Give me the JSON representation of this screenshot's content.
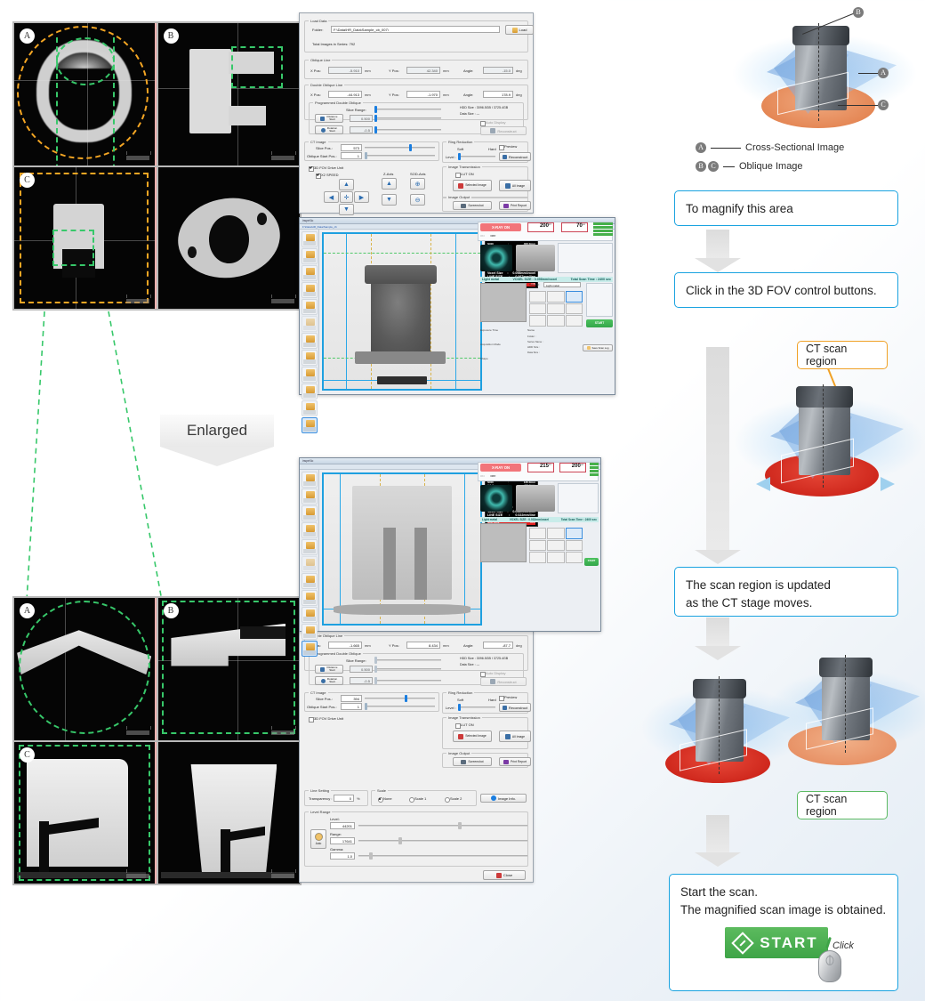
{
  "ct_views_top": {
    "panel_labels": [
      "A",
      "B",
      "C",
      ""
    ],
    "overlay_note": "orange and green dashed ROI guides"
  },
  "ct_views_bottom": {
    "panel_labels": [
      "A",
      "B",
      "C",
      ""
    ]
  },
  "enlarged_arrow": {
    "label": "Enlarged"
  },
  "control_panel": {
    "load_data": {
      "group": "Load Data",
      "folder_label": "Folder:",
      "folder_value": "F:\\Data\\HR_Data\\Sample_cb_007\\",
      "load_button": "Load",
      "total_images_label": "Total Images in Series: 792"
    },
    "oblique_line": {
      "group": "Oblique Line",
      "x_label": "X Pos:",
      "x_value": "-5.910",
      "x_unit": "mm",
      "y_label": "Y Pos:",
      "y_value": "42.340",
      "y_unit": "mm",
      "angle_label": "Angle:",
      "angle_value": "-15.0",
      "angle_unit": "deg"
    },
    "double_oblique_line": {
      "group": "Double Oblique Line",
      "x_label": "X Pos:",
      "x_value": "-44.913",
      "x_unit": "mm",
      "y_label": "Y Pos:",
      "y_value": "-1.970",
      "y_unit": "mm",
      "angle_label": "Angle:",
      "angle_value": "178.9",
      "angle_unit": "deg"
    },
    "programmed_double_oblique": {
      "group": "Programmed Double Oblique",
      "slice_range_label": "Slice Range:",
      "distance_button": "Distance\nStart",
      "rotation_button": "Rotation\nStart",
      "distance_value": "0.500",
      "rotation_value": "-0.5",
      "hdd_size_label": "HDD Size : 3096.5GB / 3725.4GB",
      "data_size_label": "Data Size : ---",
      "auto_display": "Auto Display",
      "reconstruct_button": "Reconstruct"
    },
    "ct_image": {
      "group": "CT Image",
      "slice_pos_label": "Slice Pos.:",
      "slice_pos_value": "573",
      "oblique_start_label": "Oblique Start Pos.:",
      "oblique_start_value": "1"
    },
    "ring_reduction": {
      "group": "Ring Reduction",
      "soft_label": "Soft",
      "hard_label": "Hard",
      "preview_label": "Preview",
      "level_label": "Level :",
      "reconstruct_button": "Reconstruct"
    },
    "fov_drive": {
      "fov_checkbox": "3D FOV Drive Unit",
      "speed_checkbox": "X2 SPEED",
      "z_axis_label": "Z-Axis",
      "sod_axis_label": "SOD-Axis"
    },
    "image_transmission": {
      "group": "Image Transmission",
      "lut_checkbox": "LUT ON",
      "selected_image_button": "Selected Image",
      "all_image_button": "All Image"
    },
    "image_output": {
      "group": "Image Output",
      "screenshot_button": "Screenshot",
      "print_report_button": "Print Report"
    }
  },
  "control_panel_bottom": {
    "double_oblique_line": {
      "group": "Double Oblique Line",
      "x_label": "X Pos:",
      "x_value": "-1.665",
      "x_unit": "mm",
      "y_label": "Y Pos:",
      "y_value": "8.434",
      "y_unit": "mm",
      "angle_label": "Angle:",
      "angle_value": "-87.7",
      "angle_unit": "deg"
    },
    "programmed_double_oblique": {
      "group": "Programmed Double Oblique",
      "slice_range_label": "Slice Range:",
      "distance_button": "Distance\nStart",
      "rotation_button": "Rotation\nStart",
      "distance_value": "0.500",
      "rotation_value": "-0.5",
      "hdd_size_label": "HDD Size : 3096.5GB / 3725.4GB",
      "data_size_label": "Data Size : ---",
      "auto_display": "Auto Display",
      "reconstruct_button": "Reconstruct"
    },
    "ct_image": {
      "group": "CT Image",
      "slice_pos_label": "Slice Pos.:",
      "slice_pos_value": "394",
      "oblique_start_label": "Oblique Start Pos.:",
      "oblique_start_value": "1"
    },
    "ring_reduction": {
      "group": "Ring Reduction",
      "soft_label": "Soft",
      "hard_label": "Hard",
      "preview_label": "Preview",
      "level_label": "Level :",
      "reconstruct_button": "Reconstruct"
    },
    "fov_drive": {
      "fov_checkbox": "3D FOV Drive Unit"
    },
    "image_transmission": {
      "group": "Image Transmission",
      "lut_checkbox": "LUT ON",
      "selected_image_button": "Selected Image",
      "all_image_button": "All Image"
    },
    "image_output": {
      "group": "Image Output",
      "screenshot_button": "Screenshot",
      "print_report_button": "Print Report"
    },
    "line_setting": {
      "group": "Line Setting",
      "transparency_label": "Transparency :",
      "transparency_value": "0",
      "transparency_unit": "%"
    },
    "scale": {
      "group": "Scale",
      "options": [
        "None",
        "Scale 1",
        "Scale 2"
      ],
      "selected": "None",
      "image_info_button": "Image Info."
    },
    "level_range": {
      "group": "Level Range",
      "level_label": "Level:",
      "level_value": "44201",
      "range_label": "Range:",
      "range_value": "17641",
      "gamma_label": "Gamma:",
      "gamma_value": "1.0",
      "auto_button": "Auto"
    },
    "close_button": "Close"
  },
  "scan_window_top": {
    "title": "inspeXio",
    "breadcrumb": "F:\\Data\\HR_Data\\Sample_cb",
    "xray_status": "X-RAY ON",
    "toggle_on": "ON",
    "toggle_off": "OFF",
    "voltage_value": "200",
    "voltage_unit": "kV",
    "current_value": "70",
    "current_unit": "uA",
    "information": {
      "header": "Information",
      "rows": [
        {
          "k": "SID",
          "v": "800.0mm"
        },
        {
          "k": "SOD",
          "v": "400.0mm"
        },
        {
          "k": "CT-Z",
          "v": "201.5mm"
        },
        {
          "k": "CT-Theta",
          "v": "0.0 deg."
        },
        {
          "k": "X",
          "v": "0.0mm"
        },
        {
          "k": "Y",
          "v": "0.0mm"
        },
        {
          "k": "Inch Size",
          "v": "16.4inch"
        },
        {
          "k": "FOV (Z)",
          "v": "150.0mm"
        },
        {
          "k": "FOV (XY)",
          "v": "201.7mm"
        },
        {
          "k": "Voxel Size",
          "v": "0.098mm/voxel"
        },
        {
          "k": "LINE SIZE",
          "v": "0.067mm/line"
        },
        {
          "k": "Sample Size",
          "v": "150.0mm"
        },
        {
          "k": "SoR Limit",
          "v": "ON"
        }
      ]
    },
    "scan_settings": {
      "material_bar": "Light metal",
      "voxel_bar": "VOXEL SIZE : 0.098mm/voxel",
      "time_bar": "Total Scan Time : 2400 sec",
      "material_label": "Material :",
      "material_value": "Light metal",
      "start_button": "START",
      "save_button": "Save Scan Log",
      "exposure_label": "Exposure Time",
      "acquisition_label": "Acquisition Mode",
      "shape_label": "Shape",
      "average_label": "Average",
      "name_label": "Name",
      "folder_label": "Folder :",
      "series_label": "Series Name :",
      "hdd_label": "HDD Size :",
      "data_label": "Data Size :"
    }
  },
  "scan_window_bottom": {
    "title": "inspeXio",
    "xray_status": "X-RAY ON",
    "toggle_on": "ON",
    "toggle_off": "OFF",
    "voltage_value": "215",
    "voltage_unit": "kV",
    "current_value": "200",
    "current_unit": "uA",
    "information": {
      "header": "Information",
      "rows": [
        {
          "k": "SID",
          "v": "800.0mm"
        },
        {
          "k": "SOD",
          "v": "130.0mm"
        },
        {
          "k": "CT-Z",
          "v": "253.5mm"
        },
        {
          "k": "CT-Theta",
          "v": "0.0 deg."
        },
        {
          "k": "X",
          "v": "1.5mm"
        },
        {
          "k": "Y",
          "v": "47.8mm"
        },
        {
          "k": "Inch Size",
          "v": "16.4inch"
        },
        {
          "k": "FOV (Z)",
          "v": "50.5mm"
        },
        {
          "k": "FOV (XY)",
          "v": "65.0mm"
        },
        {
          "k": "Voxel Size",
          "v": "0.032mm/voxel"
        },
        {
          "k": "LINE SIZE",
          "v": "0.022mm/line"
        },
        {
          "k": "Sample Size",
          "v": "150.0mm"
        },
        {
          "k": "SoR Limit",
          "v": "OFF"
        }
      ]
    },
    "scan_settings": {
      "material_bar": "Light metal",
      "voxel_bar": "VOXEL SIZE : 0.032mm/voxel",
      "time_bar": "Total Scan Time : 2400 sec",
      "start_button": "START"
    }
  },
  "flow": {
    "legend": [
      {
        "badges": [
          "A"
        ],
        "text": "Cross-Sectional Image"
      },
      {
        "badges": [
          "B",
          "C"
        ],
        "text": "Oblique Image"
      }
    ],
    "step1": "To magnify this area",
    "step2": "Click in the 3D FOV control buttons.",
    "step3_line1": "The scan region is updated",
    "step3_line2": "as the CT stage moves.",
    "step4_line1": "Start the scan.",
    "step4_line2": "The magnified scan image is obtained.",
    "tag_orange": "CT scan region",
    "tag_green": "CT scan region",
    "start_button": "START",
    "click_label": "Click"
  },
  "diagram_top": {
    "labels": [
      "A",
      "B",
      "C"
    ]
  },
  "colors": {
    "callout_border": "#1aa3e0",
    "tag_orange_border": "#f0a126",
    "tag_green_border": "#5cba63",
    "dash_green": "#37c86a",
    "dash_orange": "#f5a623",
    "xray_chip": "#f2757a",
    "start_green": "#3ea447",
    "disc_red": "#d9261c",
    "disc_orange": "#e8956a",
    "plane_blue": "#6ea0dc"
  }
}
